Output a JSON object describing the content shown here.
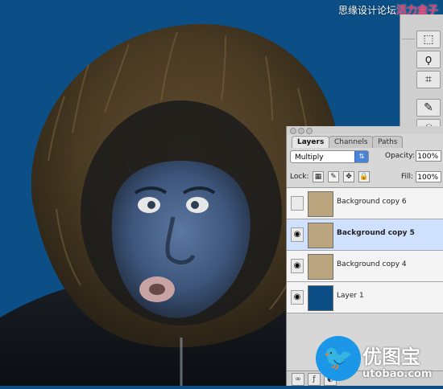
{
  "watermark": {
    "site_cn": "思缘设计论坛",
    "brand_cn": "活力盒子"
  },
  "photo": {
    "background_color": "#0b4f86",
    "subject": "person in fur-trimmed hood"
  },
  "tools": [
    {
      "icon": "marquee-icon"
    },
    {
      "icon": "lasso-icon"
    },
    {
      "icon": "crop-icon"
    },
    {
      "icon": "healing-brush-icon"
    },
    {
      "icon": "clone-stamp-icon"
    }
  ],
  "layers_panel": {
    "tabs": [
      {
        "label": "Layers",
        "active": true
      },
      {
        "label": "Channels",
        "active": false
      },
      {
        "label": "Paths",
        "active": false
      }
    ],
    "blend_mode": "Multiply",
    "opacity_label": "Opacity:",
    "opacity_value": "100%",
    "lock_label": "Lock:",
    "fill_label": "Fill:",
    "fill_value": "100%",
    "layers": [
      {
        "name": "Background copy 6",
        "visible": false,
        "selected": false,
        "thumb": "photo"
      },
      {
        "name": "Background copy 5",
        "visible": true,
        "selected": true,
        "thumb": "photo"
      },
      {
        "name": "Background copy 4",
        "visible": true,
        "selected": false,
        "thumb": "photo"
      },
      {
        "name": "Layer 1",
        "visible": true,
        "selected": false,
        "thumb": "solid-blue"
      }
    ],
    "bottom_icons": [
      "link-icon",
      "fx-icon",
      "mask-icon"
    ]
  },
  "logo": {
    "site_cn": "优图宝",
    "url": "utobao.com"
  }
}
